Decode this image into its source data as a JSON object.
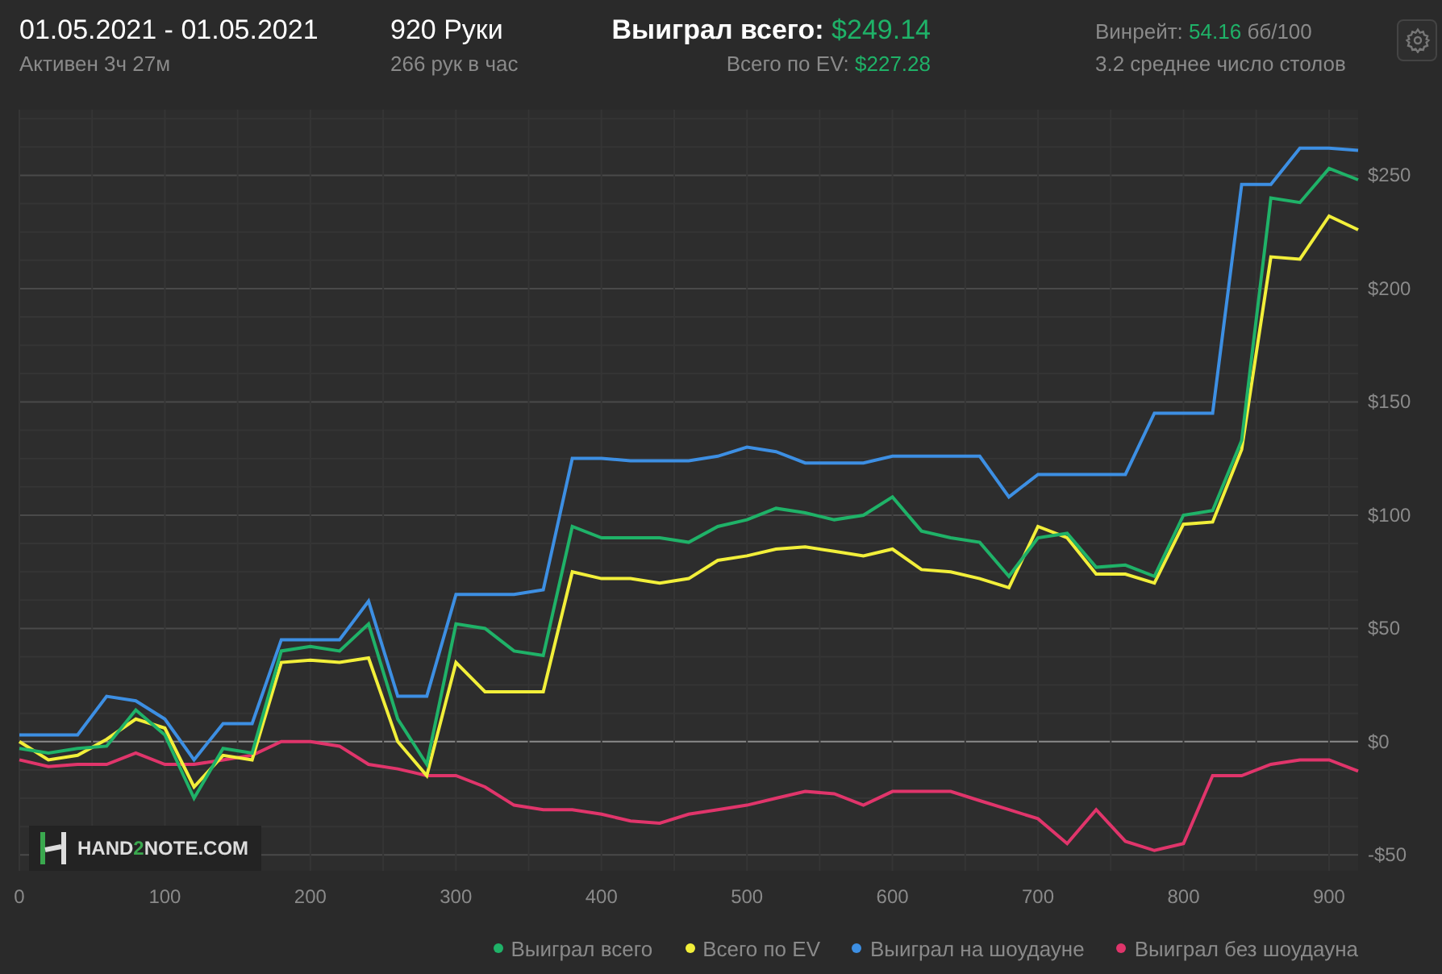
{
  "header": {
    "date_range": "01.05.2021 - 01.05.2021",
    "active_time": "Активен 3ч 27м",
    "hands": "920 Руки",
    "hands_per_hour": "266 рук в час",
    "total_won": {
      "label": "Выиграл всего:",
      "value": "$249.14"
    },
    "ev_total": {
      "label": "Всего по EV:",
      "value": "$227.28"
    },
    "winrate": {
      "label": "Винрейт:",
      "value": "54.16",
      "unit": "бб/100"
    },
    "avg_tables": "3.2 среднее число столов"
  },
  "chart": {
    "logo": {
      "parts": [
        "HAND",
        "2",
        "NOTE.COM"
      ]
    },
    "chart_data": {
      "type": "line",
      "grid": true,
      "xlim": [
        0,
        920
      ],
      "ylim": [
        -57,
        279
      ],
      "xticks": [
        0,
        100,
        200,
        300,
        400,
        500,
        600,
        700,
        800,
        900
      ],
      "yticks": [
        {
          "value": -50,
          "label": "-$50"
        },
        {
          "value": 0,
          "label": "$0"
        },
        {
          "value": 50,
          "label": "$50"
        },
        {
          "value": 100,
          "label": "$100"
        },
        {
          "value": 150,
          "label": "$150"
        },
        {
          "value": 200,
          "label": "$200"
        },
        {
          "value": 250,
          "label": "$250"
        }
      ],
      "x": [
        0,
        20,
        40,
        60,
        80,
        100,
        120,
        140,
        160,
        180,
        200,
        220,
        240,
        260,
        280,
        300,
        320,
        340,
        360,
        380,
        400,
        420,
        440,
        460,
        480,
        500,
        520,
        540,
        560,
        580,
        600,
        620,
        640,
        660,
        680,
        700,
        720,
        740,
        760,
        780,
        800,
        820,
        840,
        860,
        880,
        900,
        920
      ],
      "series": [
        {
          "name": "Выиграл всего",
          "color": "#1fb268",
          "values": [
            -3,
            -5,
            -3,
            -2,
            14,
            3,
            -25,
            -3,
            -5,
            40,
            42,
            40,
            52,
            10,
            -10,
            52,
            50,
            40,
            38,
            95,
            90,
            90,
            90,
            88,
            95,
            98,
            103,
            101,
            98,
            100,
            108,
            93,
            90,
            88,
            73,
            90,
            92,
            77,
            78,
            73,
            100,
            102,
            133,
            240,
            238,
            253,
            248
          ]
        },
        {
          "name": "Всего по EV",
          "color": "#f2ef3a",
          "values": [
            0,
            -8,
            -6,
            1,
            10,
            6,
            -20,
            -6,
            -8,
            35,
            36,
            35,
            37,
            0,
            -15,
            35,
            22,
            22,
            22,
            75,
            72,
            72,
            70,
            72,
            80,
            82,
            85,
            86,
            84,
            82,
            85,
            76,
            75,
            72,
            68,
            95,
            90,
            74,
            74,
            70,
            96,
            97,
            129,
            214,
            213,
            232,
            226
          ]
        },
        {
          "name": "Выиграл на шоудауне",
          "color": "#3d8fe3",
          "values": [
            3,
            3,
            3,
            20,
            18,
            10,
            -8,
            8,
            8,
            45,
            45,
            45,
            62,
            20,
            20,
            65,
            65,
            65,
            67,
            125,
            125,
            124,
            124,
            124,
            126,
            130,
            128,
            123,
            123,
            123,
            126,
            126,
            126,
            126,
            108,
            118,
            118,
            118,
            118,
            145,
            145,
            145,
            246,
            246,
            262,
            262,
            261
          ]
        },
        {
          "name": "Выиграл без шоудауна",
          "color": "#e0356b",
          "values": [
            -8,
            -11,
            -10,
            -10,
            -5,
            -10,
            -10,
            -8,
            -6,
            0,
            0,
            -2,
            -10,
            -12,
            -15,
            -15,
            -20,
            -28,
            -30,
            -30,
            -32,
            -35,
            -36,
            -32,
            -30,
            -28,
            -25,
            -22,
            -23,
            -28,
            -22,
            -22,
            -22,
            -26,
            -30,
            -34,
            -45,
            -30,
            -44,
            -48,
            -45,
            -15,
            -15,
            -10,
            -8,
            -8,
            -13
          ]
        }
      ]
    }
  }
}
